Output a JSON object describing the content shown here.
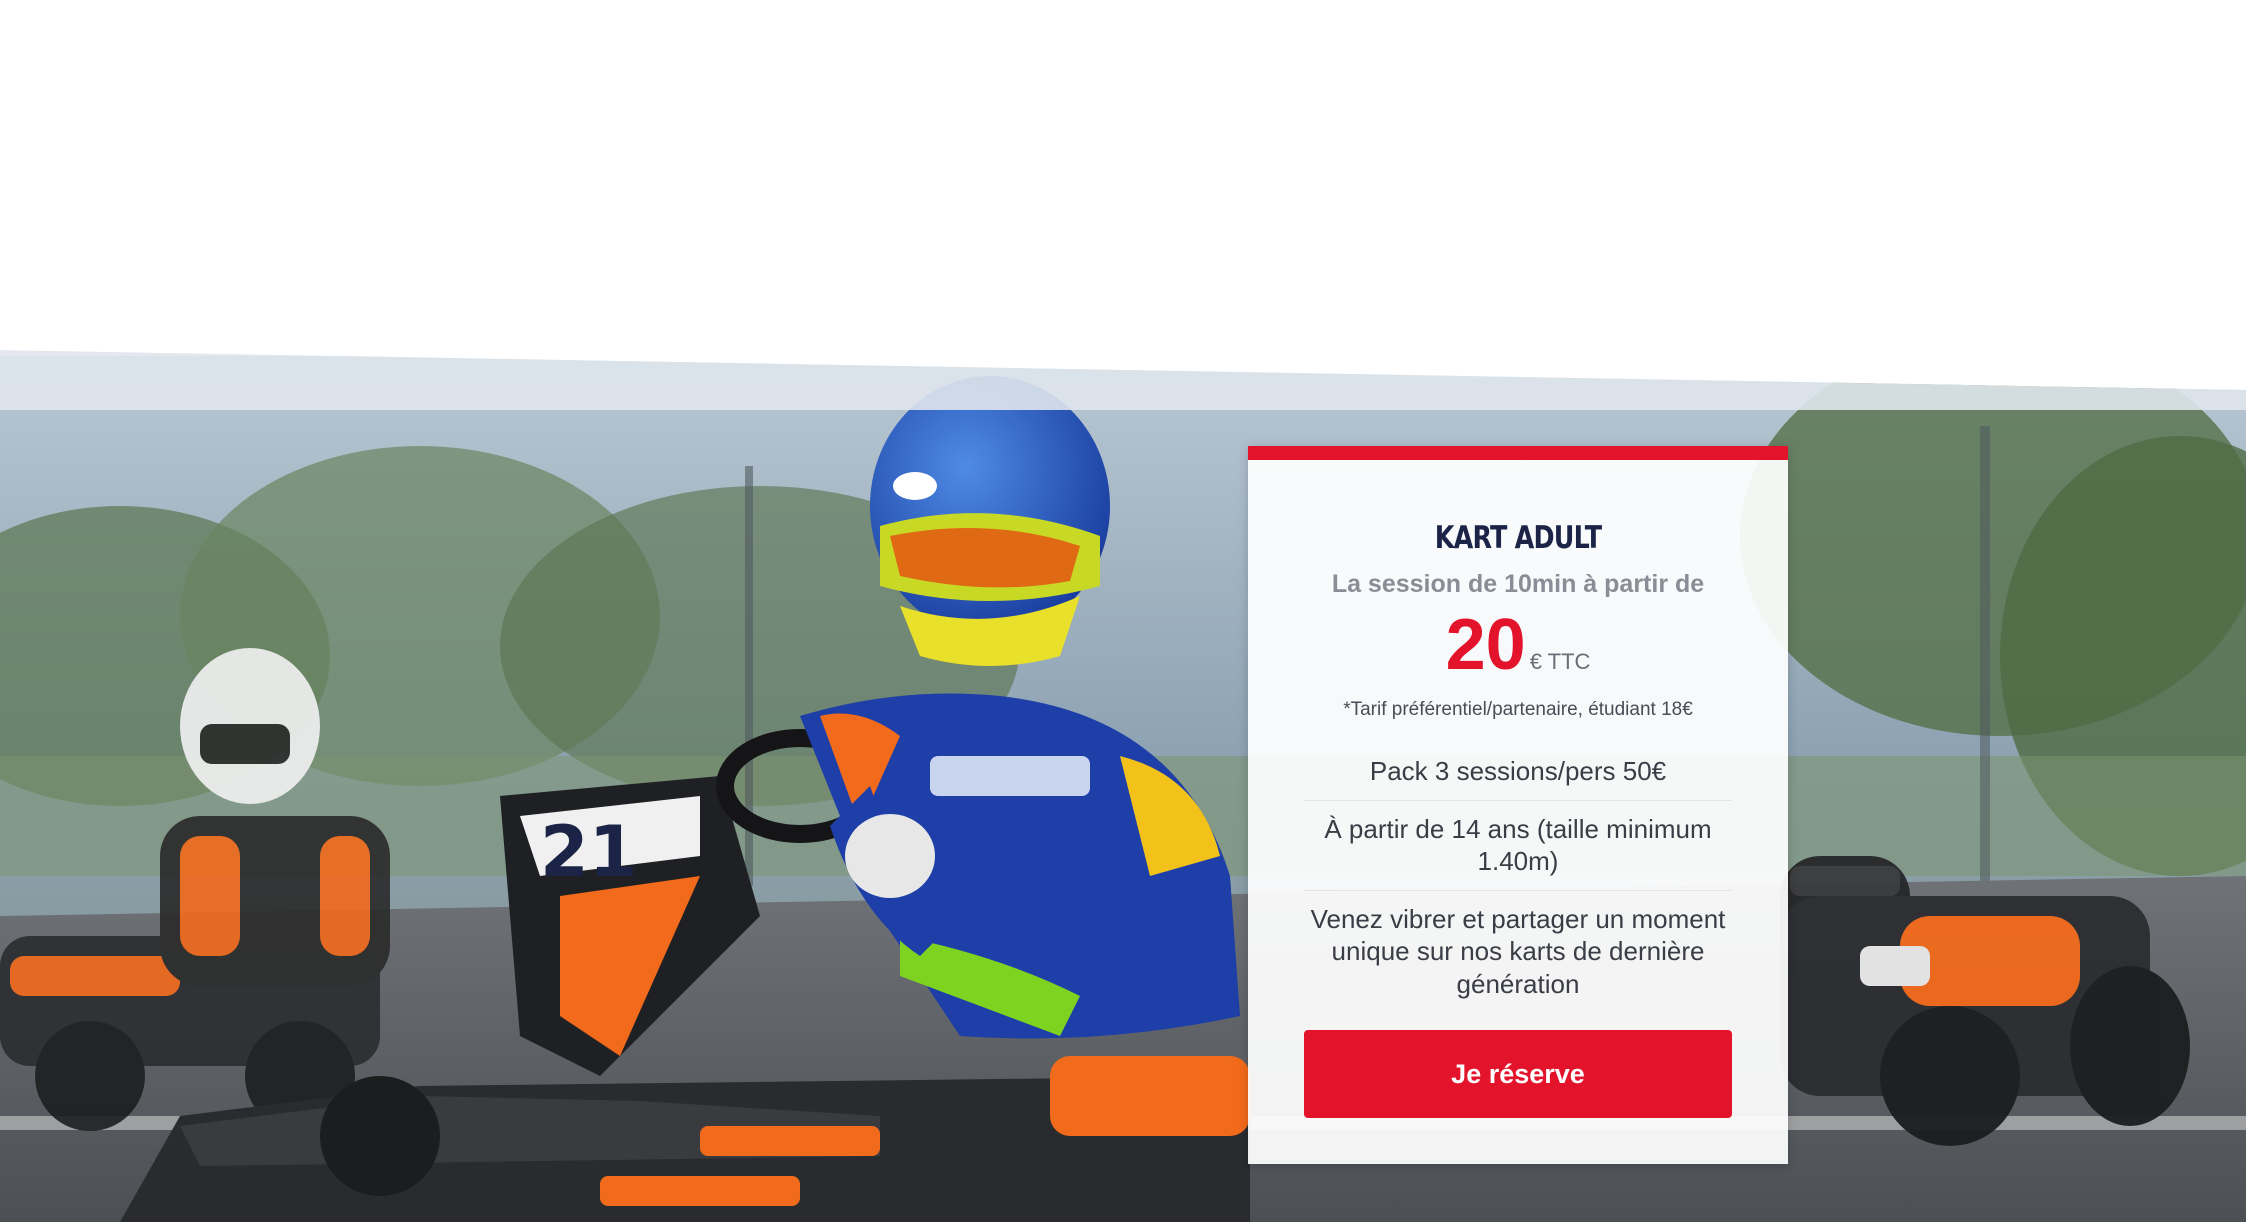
{
  "offer": {
    "title": "KART ADULT",
    "subtitle": "La session de 10min à partir de",
    "price": "20",
    "price_unit": "€ TTC",
    "price_note": "*Tarif préférentiel/partenaire, étudiant 18€",
    "features": [
      "Pack 3 sessions/pers 50€",
      "À partir de 14 ans (taille minimum 1.40m)",
      "Venez vibrer et partager un moment unique sur nos karts de dernière génération"
    ],
    "cta_label": "Je réserve"
  },
  "hero": {
    "kart_number": "21",
    "colors": {
      "accent_red": "#e2132a",
      "title_navy": "#1b2447",
      "kart_orange": "#f26a1b",
      "suit_blue": "#1f3fa8"
    }
  }
}
